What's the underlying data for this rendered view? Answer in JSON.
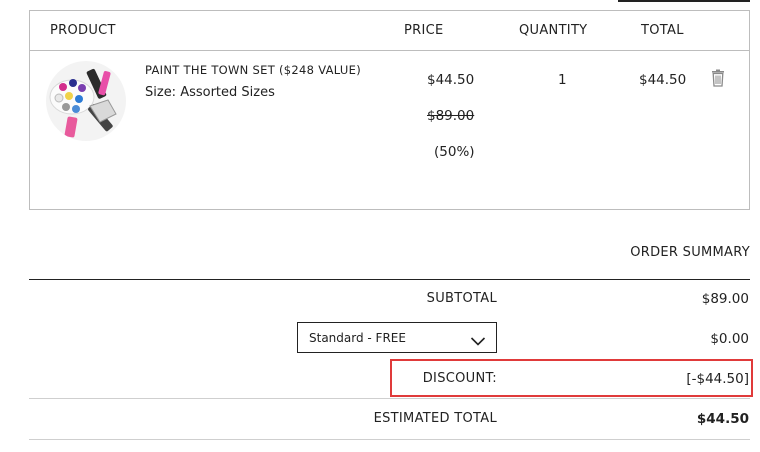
{
  "cart": {
    "headers": {
      "product": "PRODUCT",
      "price": "PRICE",
      "quantity": "QUANTITY",
      "total": "TOTAL"
    },
    "items": [
      {
        "name": "PAINT THE TOWN SET ($248 VALUE)",
        "size": "Size: Assorted Sizes",
        "price": "$44.50",
        "original_price": "$89.00",
        "discount_pct": "(50%)",
        "quantity": "1",
        "total": "$44.50",
        "remove_icon": "trash-icon"
      }
    ]
  },
  "summary": {
    "title": "ORDER SUMMARY",
    "subtotal_label": "SUBTOTAL",
    "subtotal_value": "$89.00",
    "shipping_selected": "Standard - FREE",
    "shipping_value": "$0.00",
    "discount_label": "DISCOUNT:",
    "discount_value": "[-$44.50]",
    "estimated_total_label": "ESTIMATED TOTAL",
    "estimated_total_value": "$44.50"
  },
  "colors": {
    "highlight": "#e03a3a",
    "text": "#222222",
    "border": "#bdbdbd"
  }
}
